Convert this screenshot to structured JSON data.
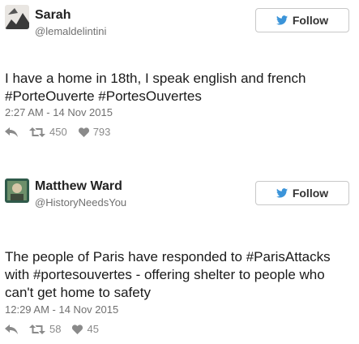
{
  "tweets": [
    {
      "author_name": "Sarah",
      "handle": "@lemaldelintini",
      "follow_label": "Follow",
      "text_parts": [
        "I have a home in 18th, I speak english and french ",
        "#PorteOuverte",
        " ",
        "#PortesOuvertes"
      ],
      "timestamp": "2:27 AM - 14 Nov 2015",
      "retweets": "450",
      "likes": "793"
    },
    {
      "author_name": "Matthew Ward",
      "handle": "@HistoryNeedsYou",
      "follow_label": "Follow",
      "text_parts": [
        "The people of Paris have responded to ",
        "#ParisAttacks",
        " with ",
        "#portesouvertes",
        " - offering shelter to people who can't get home to safety"
      ],
      "timestamp": "12:29 AM - 14 Nov 2015",
      "retweets": "58",
      "likes": "45"
    }
  ],
  "icons": {
    "follow": "twitter-bird-icon",
    "reply": "reply-icon",
    "retweet": "retweet-icon",
    "like": "heart-icon"
  }
}
